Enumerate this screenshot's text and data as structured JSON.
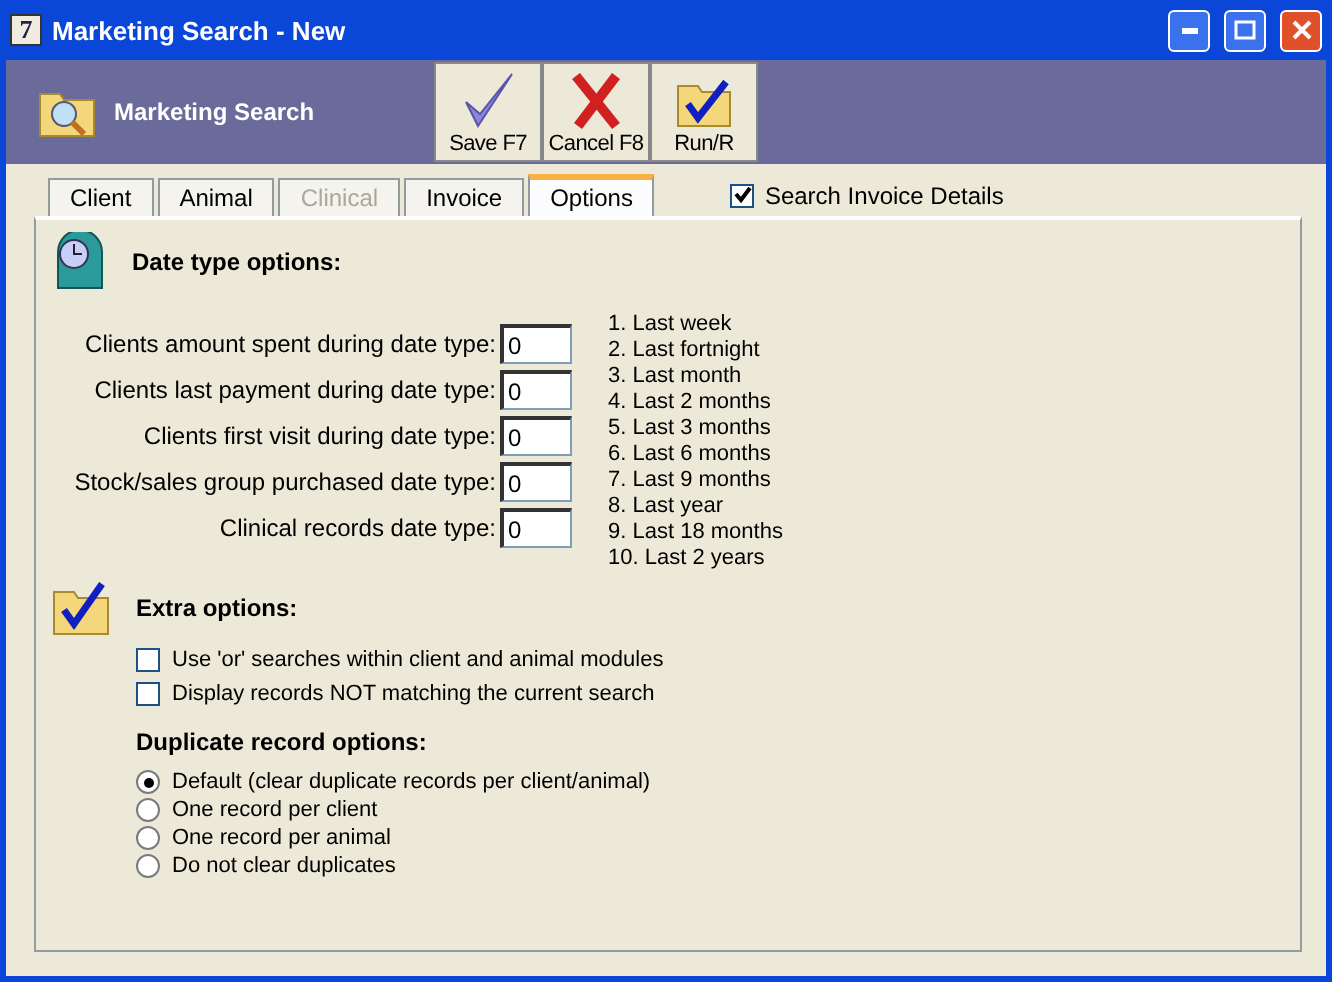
{
  "window": {
    "title": "Marketing Search - New",
    "app_icon": "7"
  },
  "header": {
    "title": "Marketing Search"
  },
  "toolbar": [
    {
      "label": "Save F7",
      "kind": "save"
    },
    {
      "label": "Cancel F8",
      "kind": "cancel"
    },
    {
      "label": "Run/R",
      "kind": "run"
    }
  ],
  "tabs": [
    {
      "label": "Client",
      "selected": false,
      "disabled": false
    },
    {
      "label": "Animal",
      "selected": false,
      "disabled": false
    },
    {
      "label": "Clinical",
      "selected": false,
      "disabled": true
    },
    {
      "label": "Invoice",
      "selected": false,
      "disabled": false
    },
    {
      "label": "Options",
      "selected": true,
      "disabled": false
    }
  ],
  "search_invoice": {
    "label": "Search Invoice Details",
    "checked": true
  },
  "date_section": {
    "title": "Date type options:",
    "fields": [
      {
        "label": "Clients amount spent during date type:",
        "value": "0"
      },
      {
        "label": "Clients last payment during date type:",
        "value": "0"
      },
      {
        "label": "Clients first visit during date type:",
        "value": "0"
      },
      {
        "label": "Stock/sales group purchased date type:",
        "value": "0"
      },
      {
        "label": "Clinical records date type:",
        "value": "0"
      }
    ],
    "legend": [
      "1. Last week",
      "2. Last fortnight",
      "3. Last month",
      "4. Last 2 months",
      "5. Last 3 months",
      "6. Last 6 months",
      "7. Last 9 months",
      "8. Last year",
      "9. Last 18 months",
      "10. Last 2 years"
    ]
  },
  "extra_section": {
    "title": "Extra options:",
    "checkboxes": [
      {
        "label": "Use 'or' searches within client and animal modules",
        "checked": false
      },
      {
        "label": "Display records NOT matching the current search",
        "checked": false
      }
    ],
    "duplicate_title": "Duplicate record options:",
    "radios": [
      {
        "label": "Default (clear duplicate records per client/animal)",
        "selected": true
      },
      {
        "label": "One record per client",
        "selected": false
      },
      {
        "label": "One record per animal",
        "selected": false
      },
      {
        "label": "Do not clear duplicates",
        "selected": false
      }
    ]
  }
}
